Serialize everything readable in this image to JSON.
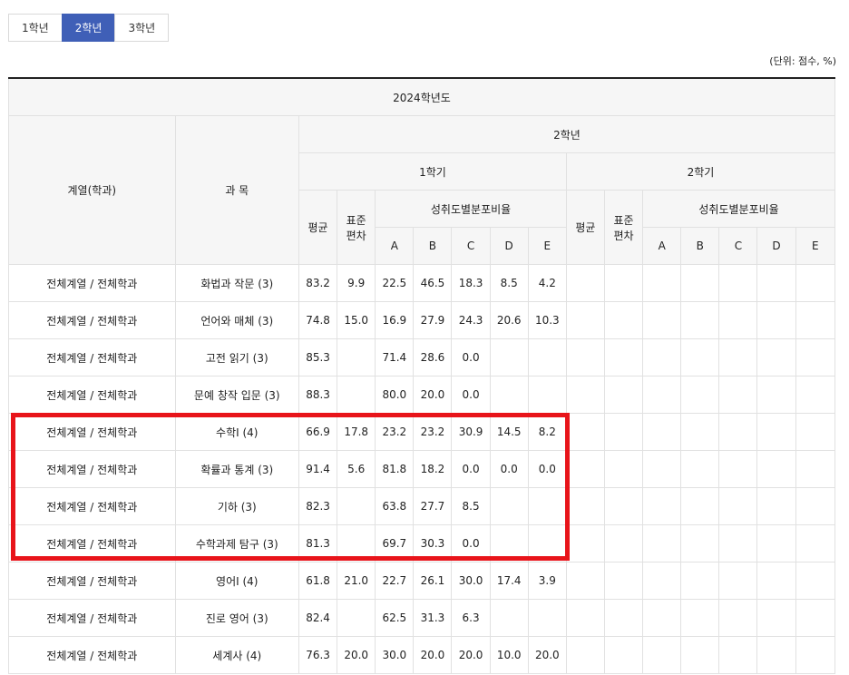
{
  "tabs": [
    {
      "label": "1학년",
      "active": false
    },
    {
      "label": "2학년",
      "active": true
    },
    {
      "label": "3학년",
      "active": false
    }
  ],
  "unit_note": "(단위: 점수, %)",
  "table": {
    "year": "2024학년도",
    "grade": "2학년",
    "col_dept": "계열(학과)",
    "col_subject": "과 목",
    "sem1": "1학기",
    "sem2": "2학기",
    "avg": "평균",
    "std_line1": "표준",
    "std_line2": "편차",
    "dist": "성취도별분포비율",
    "grades": [
      "A",
      "B",
      "C",
      "D",
      "E"
    ],
    "rows": [
      {
        "dept": "전체계열 / 전체학과",
        "subject": "화법과 작문 (3)",
        "avg": "83.2",
        "std": "9.9",
        "a": "22.5",
        "b": "46.5",
        "c": "18.3",
        "d": "8.5",
        "e": "4.2"
      },
      {
        "dept": "전체계열 / 전체학과",
        "subject": "언어와 매체 (3)",
        "avg": "74.8",
        "std": "15.0",
        "a": "16.9",
        "b": "27.9",
        "c": "24.3",
        "d": "20.6",
        "e": "10.3"
      },
      {
        "dept": "전체계열 / 전체학과",
        "subject": "고전 읽기 (3)",
        "avg": "85.3",
        "std": "",
        "a": "71.4",
        "b": "28.6",
        "c": "0.0",
        "d": "",
        "e": ""
      },
      {
        "dept": "전체계열 / 전체학과",
        "subject": "문예 창작 입문 (3)",
        "avg": "88.3",
        "std": "",
        "a": "80.0",
        "b": "20.0",
        "c": "0.0",
        "d": "",
        "e": ""
      },
      {
        "dept": "전체계열 / 전체학과",
        "subject": "수학Ⅰ (4)",
        "avg": "66.9",
        "std": "17.8",
        "a": "23.2",
        "b": "23.2",
        "c": "30.9",
        "d": "14.5",
        "e": "8.2"
      },
      {
        "dept": "전체계열 / 전체학과",
        "subject": "확률과 통계 (3)",
        "avg": "91.4",
        "std": "5.6",
        "a": "81.8",
        "b": "18.2",
        "c": "0.0",
        "d": "0.0",
        "e": "0.0"
      },
      {
        "dept": "전체계열 / 전체학과",
        "subject": "기하 (3)",
        "avg": "82.3",
        "std": "",
        "a": "63.8",
        "b": "27.7",
        "c": "8.5",
        "d": "",
        "e": ""
      },
      {
        "dept": "전체계열 / 전체학과",
        "subject": "수학과제 탐구 (3)",
        "avg": "81.3",
        "std": "",
        "a": "69.7",
        "b": "30.3",
        "c": "0.0",
        "d": "",
        "e": ""
      },
      {
        "dept": "전체계열 / 전체학과",
        "subject": "영어Ⅰ (4)",
        "avg": "61.8",
        "std": "21.0",
        "a": "22.7",
        "b": "26.1",
        "c": "30.0",
        "d": "17.4",
        "e": "3.9"
      },
      {
        "dept": "전체계열 / 전체학과",
        "subject": "진로 영어 (3)",
        "avg": "82.4",
        "std": "",
        "a": "62.5",
        "b": "31.3",
        "c": "6.3",
        "d": "",
        "e": ""
      },
      {
        "dept": "전체계열 / 전체학과",
        "subject": "세계사 (4)",
        "avg": "76.3",
        "std": "20.0",
        "a": "30.0",
        "b": "20.0",
        "c": "20.0",
        "d": "10.0",
        "e": "20.0"
      }
    ]
  },
  "colors": {
    "accent": "#3f5fb7",
    "highlight": "#e8141a"
  }
}
